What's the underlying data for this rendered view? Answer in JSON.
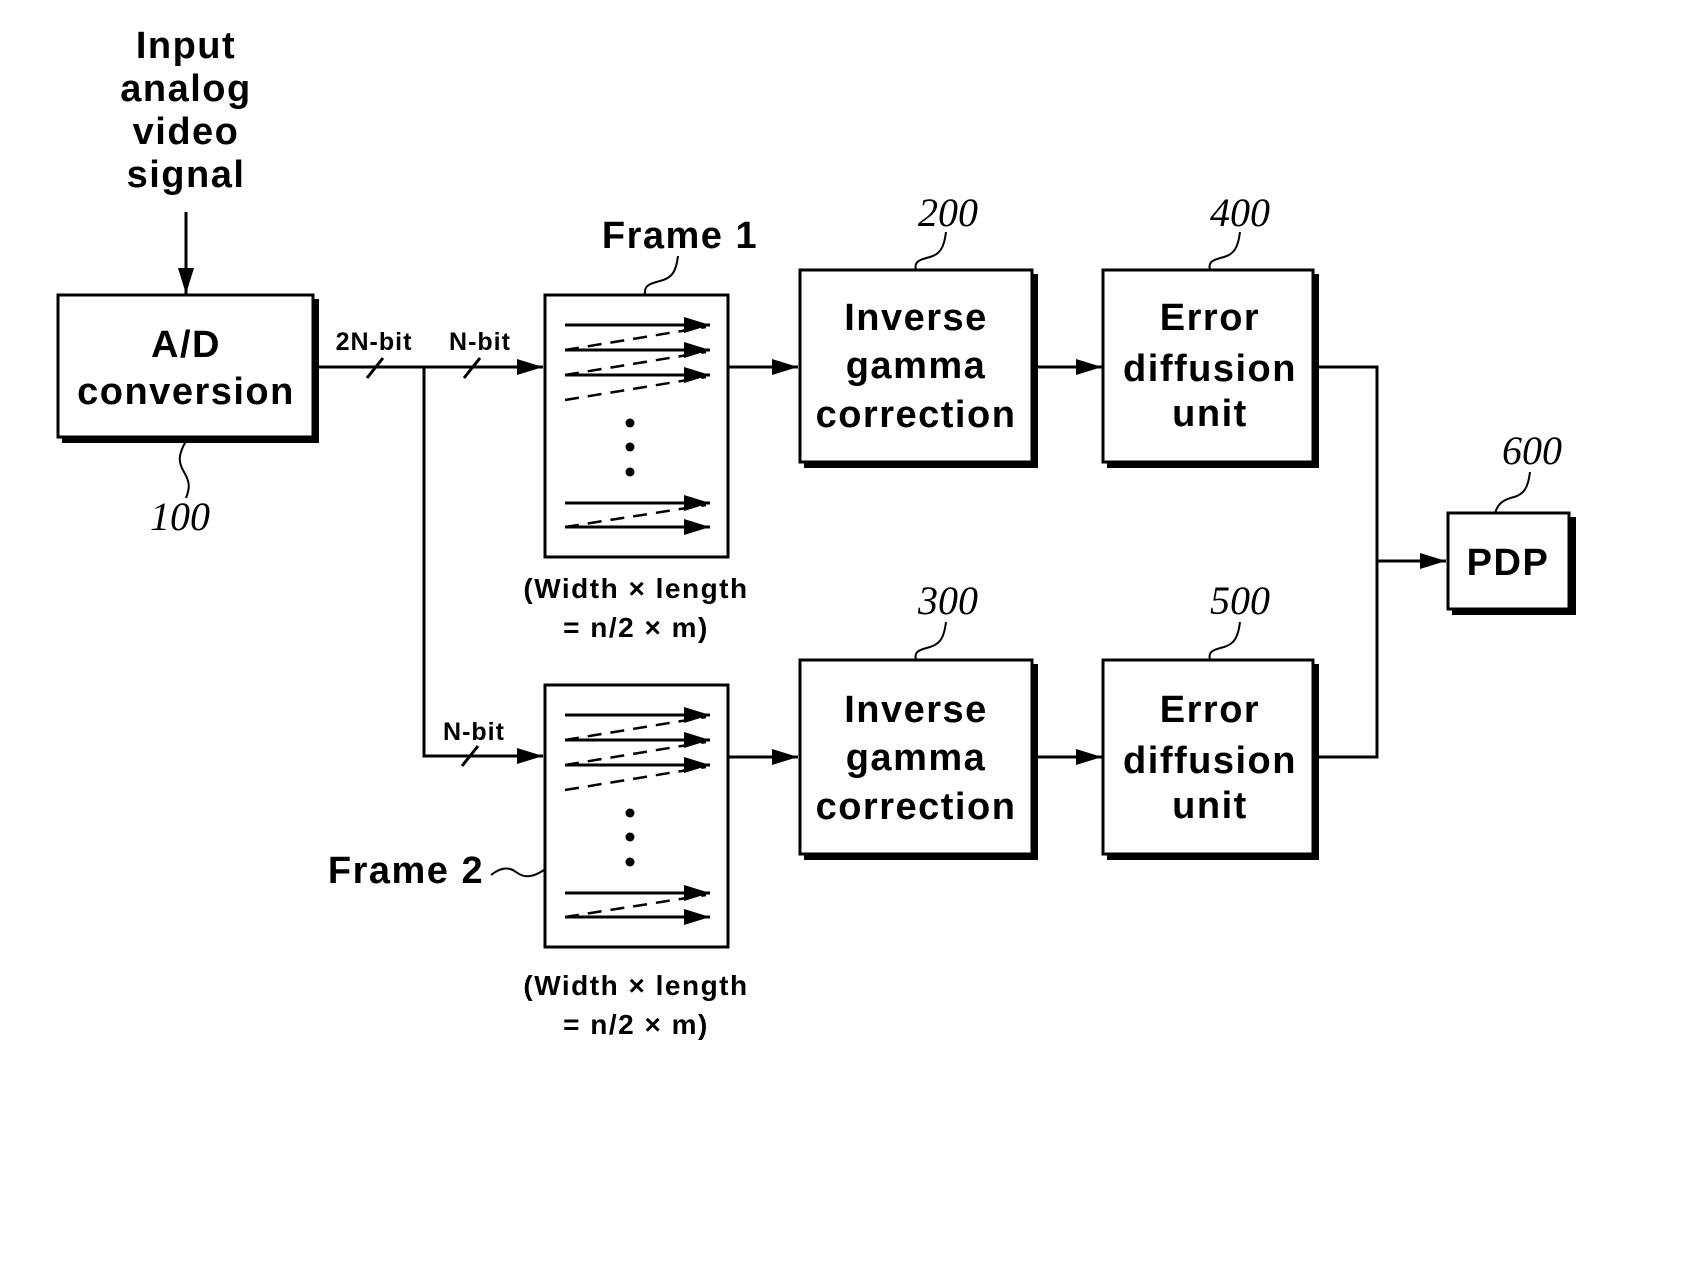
{
  "input": {
    "label_lines": [
      "Input",
      "analog",
      "video",
      "signal"
    ]
  },
  "blocks": {
    "ad": {
      "ref": "100",
      "lines": [
        "A/D",
        "conversion"
      ]
    },
    "inverse_gamma_1": {
      "ref": "200",
      "lines": [
        "Inverse",
        "gamma",
        "correction"
      ]
    },
    "inverse_gamma_2": {
      "ref": "300",
      "lines": [
        "Inverse",
        "gamma",
        "correction"
      ]
    },
    "error_diffusion_1": {
      "ref": "400",
      "lines": [
        "Error",
        "diffusion",
        "unit"
      ]
    },
    "error_diffusion_2": {
      "ref": "500",
      "lines": [
        "Error",
        "diffusion",
        "unit"
      ]
    },
    "pdp": {
      "ref": "600",
      "lines": [
        "PDP"
      ]
    }
  },
  "frames": {
    "frame1": {
      "label": "Frame 1",
      "caption": [
        "(Width × length",
        "= n/2 × m)"
      ]
    },
    "frame2": {
      "label": "Frame 2",
      "caption": [
        "(Width × length",
        "= n/2 × m)"
      ]
    }
  },
  "bus_labels": {
    "ad_out": "2N-bit",
    "frame1_in": "N-bit",
    "frame2_in": "N-bit"
  },
  "colors": {
    "line": "#000000",
    "background": "#ffffff"
  }
}
